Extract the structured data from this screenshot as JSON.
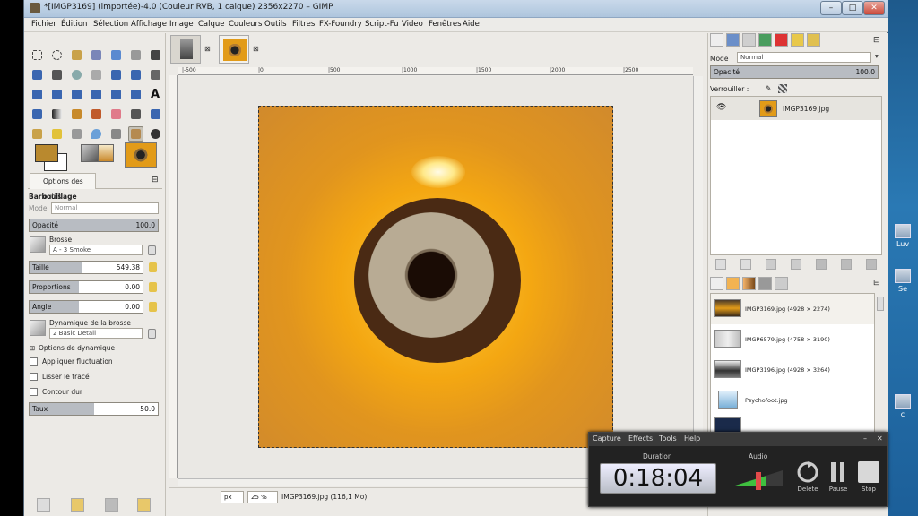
{
  "window": {
    "title": "*[IMGP3169] (importée)-4.0 (Couleur RVB, 1 calque) 2356x2270 – GIMP",
    "min": "–",
    "max": "□",
    "close": "✕"
  },
  "menu": [
    "Fichier",
    "Édition",
    "Sélection",
    "Affichage",
    "Image",
    "Calque",
    "Couleurs",
    "Outils",
    "Filtres",
    "FX-Foundry",
    "Script-Fu",
    "Video",
    "Fenêtres",
    "Aide"
  ],
  "tool_options": {
    "tab_label": "Options des outils",
    "tool_name": "Barbouillage",
    "mode_label": "Mode",
    "mode_value": "Normal",
    "opacity_label": "Opacité",
    "opacity_value": "100.0",
    "opacity_fraction": 1.0,
    "brush_label": "Brosse",
    "brush_value": "A - 3 Smoke",
    "size_label": "Taille",
    "size_value": "549.38",
    "size_fraction": 0.47,
    "proportions_label": "Proportions",
    "proportions_value": "0.00",
    "angle_label": "Angle",
    "angle_value": "0.00",
    "dynamics_label": "Dynamique de la brosse",
    "dynamics_value": "2 Basic Detail",
    "dynamics_options": "Options de dynamique",
    "apply_jitter": "Appliquer fluctuation",
    "smooth_stroke": "Lisser le tracé",
    "hard_edge": "Contour dur",
    "rate_label": "Taux",
    "rate_value": "50.0",
    "rate_fraction": 0.5
  },
  "canvas": {
    "ruler_marks": [
      "|-500",
      "|0",
      "|500",
      "|1000",
      "|1500",
      "|2000",
      "|2500"
    ],
    "unit": "px",
    "zoom": "25 %",
    "status": "IMGP3169.jpg (116,1 Mo)"
  },
  "layers": {
    "mode_label": "Mode",
    "mode_value": "Normal",
    "opacity_label": "Opacité",
    "opacity_value": "100.0",
    "lock_label": "Verrouiller :",
    "layer_name": "IMGP3169.jpg"
  },
  "images": [
    {
      "name": "IMGP3169.jpg (4928 × 2274)"
    },
    {
      "name": "IMGP6579.jpg (4758 × 3190)"
    },
    {
      "name": "IMGP3196.jpg (4928 × 3264)"
    },
    {
      "name": "Psychofoot.jpg"
    }
  ],
  "capture": {
    "menu": [
      "Capture",
      "Effects",
      "Tools",
      "Help"
    ],
    "duration_label": "Duration",
    "duration": "0:18:04",
    "audio_label": "Audio",
    "delete": "Delete",
    "pause": "Pause",
    "stop": "Stop"
  },
  "desktop_icons": [
    "Luv",
    "Se",
    "c"
  ]
}
